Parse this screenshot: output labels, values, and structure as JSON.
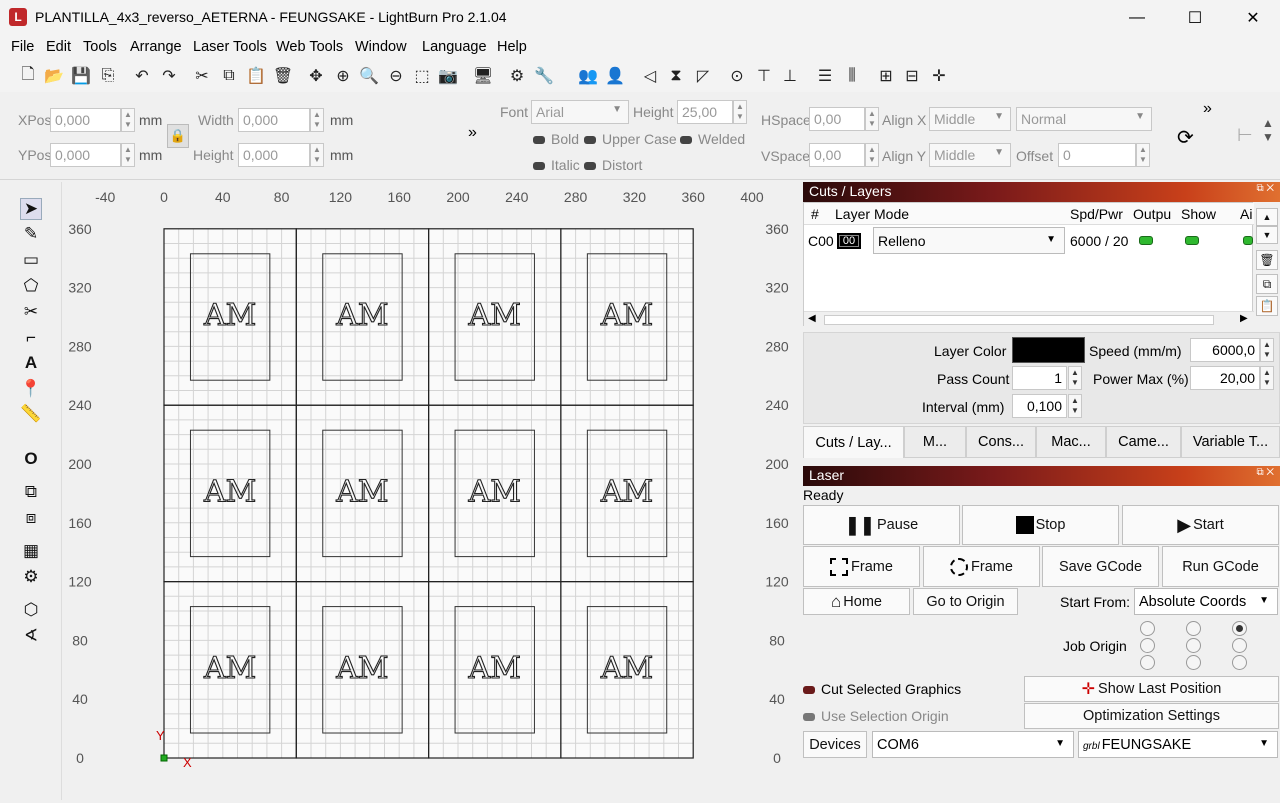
{
  "window": {
    "title": "PLANTILLA_4x3_reverso_AETERNA - FEUNGSAKE - LightBurn Pro 2.1.04",
    "minimize": "—",
    "maximize": "☐",
    "close": "✕"
  },
  "menu": [
    "File",
    "Edit",
    "Tools",
    "Arrange",
    "Laser Tools",
    "Web Tools",
    "Window",
    "Language",
    "Help"
  ],
  "props": {
    "xpos_label": "XPos",
    "xpos": "0,000",
    "ypos_label": "YPos",
    "ypos": "0,000",
    "unit": "mm",
    "width_label": "Width",
    "width": "0,000",
    "height_label": "Height",
    "height": "0,000",
    "font_label": "Font",
    "font": "Arial",
    "fheight_label": "Height",
    "fheight": "25,00",
    "bold": "Bold",
    "upper": "Upper Case",
    "welded": "Welded",
    "italic": "Italic",
    "distort": "Distort",
    "hspace_label": "HSpace",
    "hspace": "0,00",
    "vspace_label": "VSpace",
    "vspace": "0,00",
    "alignx_label": "Align X",
    "alignx": "Middle",
    "aligny_label": "Align Y",
    "aligny": "Middle",
    "normal": "Normal",
    "offset_label": "Offset",
    "offset": "0",
    "more": "»"
  },
  "ruler": {
    "x": [
      "-40",
      "0",
      "40",
      "80",
      "120",
      "160",
      "200",
      "240",
      "280",
      "320",
      "360",
      "400"
    ],
    "y": [
      "360",
      "320",
      "280",
      "240",
      "200",
      "160",
      "120",
      "80",
      "40",
      "0"
    ],
    "x_axis": "X",
    "y_axis": "Y"
  },
  "monogram": "AM",
  "cuts": {
    "title": "Cuts / Layers",
    "headers": [
      "#",
      "Layer",
      "Mode",
      "Spd/Pwr",
      "Outpu",
      "Show",
      "Ai"
    ],
    "row": {
      "num": "C00",
      "layer": "00",
      "mode": "Relleno",
      "spdpwr": "6000 / 20"
    },
    "layer_color_label": "Layer Color",
    "speed_label": "Speed (mm/m)",
    "speed": "6000,0",
    "pass_label": "Pass Count",
    "pass": "1",
    "power_label": "Power Max (%)",
    "power": "20,00",
    "interval_label": "Interval (mm)",
    "interval": "0,100",
    "layer_color": "#000000"
  },
  "tabs": [
    "Cuts / Lay...",
    "M...",
    "Cons...",
    "Mac...",
    "Came...",
    "Variable T..."
  ],
  "laser": {
    "title": "Laser",
    "status": "Ready",
    "pause": "Pause",
    "stop": "Stop",
    "start": "Start",
    "frame1": "Frame",
    "frame2": "Frame",
    "save_gcode": "Save GCode",
    "run_gcode": "Run GCode",
    "home": "Home",
    "go_origin": "Go to Origin",
    "start_from_label": "Start From:",
    "start_from": "Absolute Coords",
    "job_origin": "Job Origin",
    "cut_selected": "Cut Selected Graphics",
    "use_selection": "Use Selection Origin",
    "show_last": "Show Last Position",
    "optimization": "Optimization Settings",
    "devices": "Devices",
    "port": "COM6",
    "device_prefix": "grbl",
    "device": "FEUNGSAKE"
  },
  "colors": {
    "accent_green": "#2fb82f",
    "header_dark": "#2a0a0a",
    "header_orange": "#e07030"
  }
}
